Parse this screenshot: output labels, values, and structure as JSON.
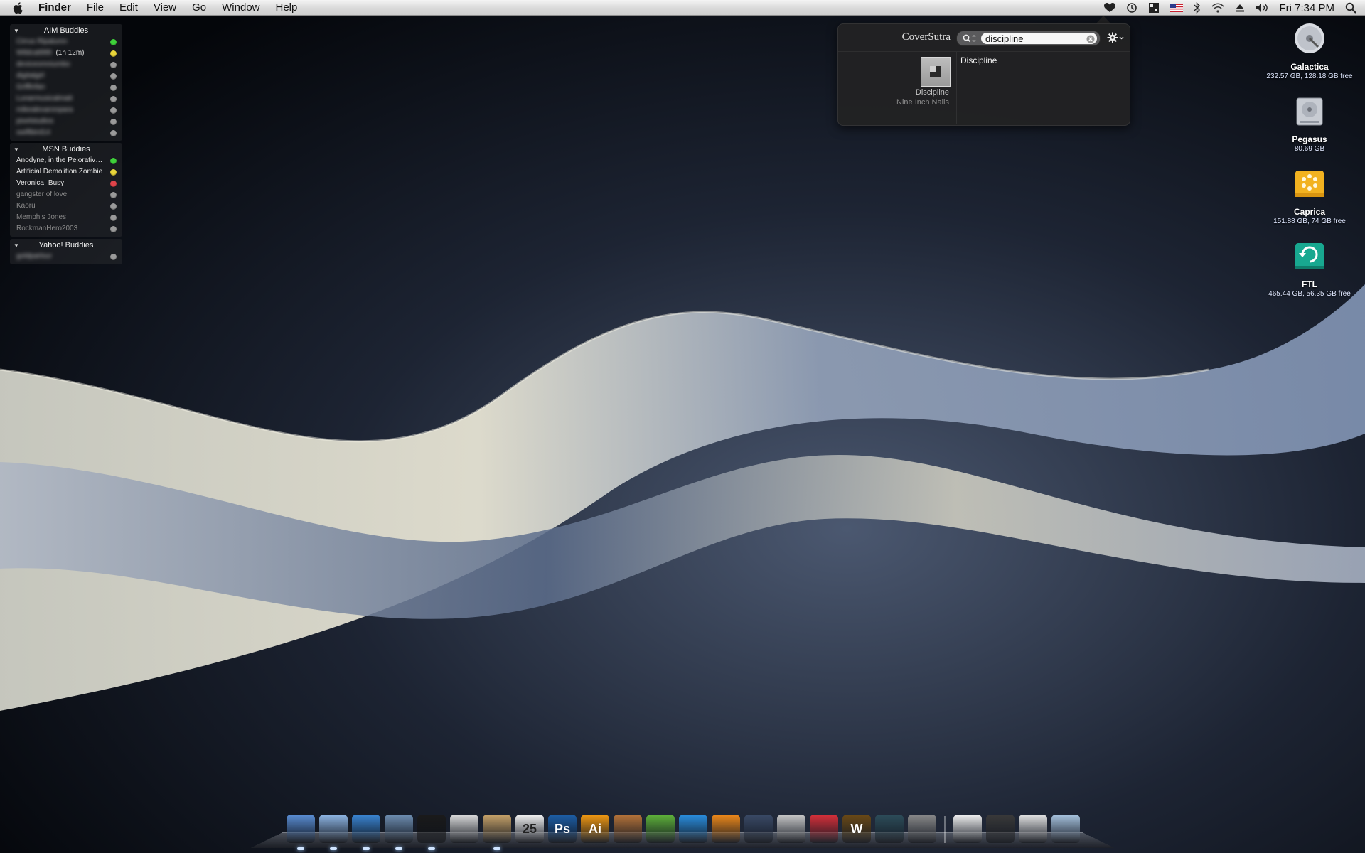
{
  "menubar": {
    "app_name": "Finder",
    "items": [
      "File",
      "Edit",
      "View",
      "Go",
      "Window",
      "Help"
    ],
    "clock": "Fri 7:34 PM"
  },
  "buddy_list": {
    "groups": [
      {
        "name": "AIM Buddies",
        "buddies": [
          {
            "name": "Cirrus Ripalumn",
            "status": "",
            "color": "#3fd13a",
            "blurred": true
          },
          {
            "name": "Wildcat999",
            "status": "(1h 12m)",
            "color": "#e8d43a",
            "blurred": true
          },
          {
            "name": "deviceomniumbo",
            "status": "",
            "color": "#9a9a9a",
            "blurred": true
          },
          {
            "name": "digitalgirl",
            "status": "",
            "color": "#9a9a9a",
            "blurred": true
          },
          {
            "name": "Griffinfan",
            "status": "",
            "color": "#9a9a9a",
            "blurred": true
          },
          {
            "name": "Lunarmusicalmatt",
            "status": "",
            "color": "#9a9a9a",
            "blurred": true
          },
          {
            "name": "mikealexaronpara",
            "status": "",
            "color": "#9a9a9a",
            "blurred": true
          },
          {
            "name": "pixelstudios",
            "status": "",
            "color": "#9a9a9a",
            "blurred": true
          },
          {
            "name": "swiftbird14",
            "status": "",
            "color": "#9a9a9a",
            "blurred": true
          }
        ]
      },
      {
        "name": "MSN Buddies",
        "buddies": [
          {
            "name": "Anodyne, in the Pejorative...",
            "status": "",
            "color": "#3fd13a",
            "blurred": false
          },
          {
            "name": "Artificial Demolition Zombie",
            "status": "",
            "color": "#e8d43a",
            "blurred": false
          },
          {
            "name": "Veronica",
            "status": "Busy",
            "color": "#e0444a",
            "blurred": false
          },
          {
            "name": "gangster of love",
            "status": "",
            "color": "#9a9a9a",
            "blurred": false,
            "idle": true
          },
          {
            "name": "Kaoru",
            "status": "",
            "color": "#9a9a9a",
            "blurred": false,
            "idle": true
          },
          {
            "name": "Memphis Jones",
            "status": "",
            "color": "#9a9a9a",
            "blurred": false,
            "idle": true
          },
          {
            "name": "RockmanHero2003",
            "status": "",
            "color": "#9a9a9a",
            "blurred": false,
            "idle": true
          }
        ]
      },
      {
        "name": "Yahoo! Buddies",
        "buddies": [
          {
            "name": "goldparlour",
            "status": "",
            "color": "#9a9a9a",
            "blurred": true
          }
        ]
      }
    ]
  },
  "coversutra": {
    "title": "CoverSutra",
    "search_value": "discipline",
    "album": "Discipline",
    "artist": "Nine Inch Nails",
    "result": "Discipline"
  },
  "desktop_icons": [
    {
      "name": "Galactica",
      "info": "232.57 GB, 128.18 GB free",
      "icon": "hard-drive-icon"
    },
    {
      "name": "Pegasus",
      "info": "80.69 GB",
      "icon": "hard-drive-icon"
    },
    {
      "name": "Caprica",
      "info": "151.88 GB, 74 GB free",
      "icon": "external-drive-icon"
    },
    {
      "name": "FTL",
      "info": "465.44 GB, 56.35 GB free",
      "icon": "time-machine-drive-icon"
    }
  ],
  "dock": {
    "apps": [
      {
        "icon": "finder-icon",
        "label": "",
        "color": "#5b8fd6",
        "running": true
      },
      {
        "icon": "itunes-icon",
        "label": "",
        "color": "#8fb7e6",
        "running": true
      },
      {
        "icon": "safari-icon",
        "label": "",
        "color": "#3b86d4",
        "running": true
      },
      {
        "icon": "mail-icon",
        "label": "",
        "color": "#6f8fb3",
        "running": true
      },
      {
        "icon": "adium-icon",
        "label": "",
        "color": "#1b1b1b",
        "running": true
      },
      {
        "icon": "textedit-icon",
        "label": "",
        "color": "#dcdcdc",
        "running": false
      },
      {
        "icon": "preview-icon",
        "label": "",
        "color": "#c9a46a",
        "running": true
      },
      {
        "icon": "ical-icon",
        "label": "25",
        "color": "#f4f4f4",
        "running": false
      },
      {
        "icon": "photoshop-icon",
        "label": "Ps",
        "color": "#1d5fa8",
        "running": false
      },
      {
        "icon": "illustrator-icon",
        "label": "Ai",
        "color": "#f39a12",
        "running": false
      },
      {
        "icon": "iphoto-icon",
        "label": "",
        "color": "#b7743a",
        "running": false
      },
      {
        "icon": "coda-icon",
        "label": "",
        "color": "#5fb33a",
        "running": false
      },
      {
        "icon": "quicktime-icon",
        "label": "",
        "color": "#2a8fe0",
        "running": false
      },
      {
        "icon": "vlc-icon",
        "label": "",
        "color": "#f08a1a",
        "running": false
      },
      {
        "icon": "network-utility-icon",
        "label": "",
        "color": "#3a4a66",
        "running": false
      },
      {
        "icon": "transmit-icon",
        "label": "",
        "color": "#c9c9c9",
        "running": false
      },
      {
        "icon": "crossover-icon",
        "label": "",
        "color": "#d8303a",
        "running": false
      },
      {
        "icon": "world-of-warcraft-icon",
        "label": "W",
        "color": "#6b4a16",
        "running": false
      },
      {
        "icon": "time-machine-icon",
        "label": "",
        "color": "#2d4d5a",
        "running": false
      },
      {
        "icon": "system-preferences-icon",
        "label": "",
        "color": "#8a8a8a",
        "running": false
      }
    ],
    "docs": [
      {
        "icon": "document-icon",
        "color": "#f2f2f2"
      },
      {
        "icon": "downloads-stack-icon",
        "color": "#3a3a3a"
      },
      {
        "icon": "documents-stack-icon",
        "color": "#e4e4e4"
      },
      {
        "icon": "trash-icon",
        "color": "#a8c4e0"
      }
    ]
  }
}
